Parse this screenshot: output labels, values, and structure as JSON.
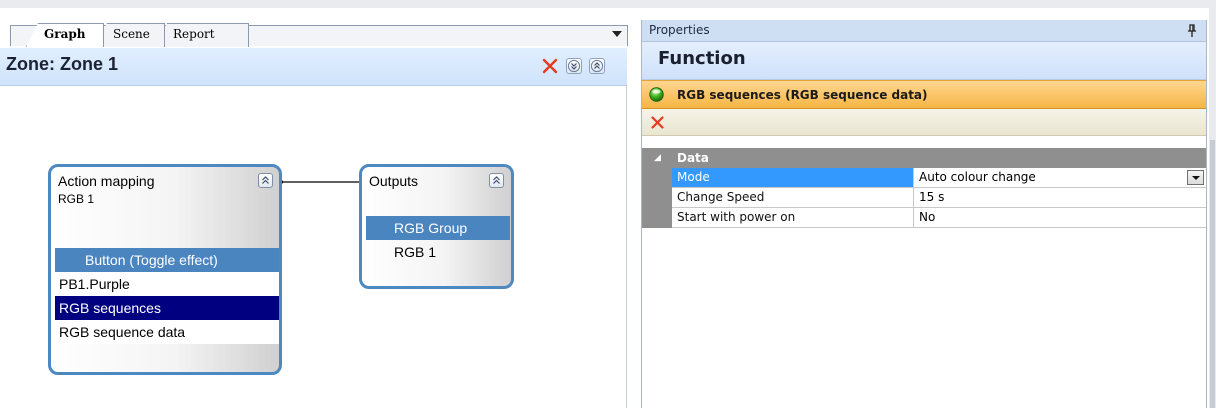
{
  "tabs": [
    "Graph",
    "Scene",
    "Report"
  ],
  "zone": {
    "title": "Zone: Zone 1"
  },
  "nodes": {
    "action": {
      "title": "Action mapping",
      "subtitle": "RGB 1",
      "items": [
        "Button (Toggle effect)",
        "PB1.Purple",
        "RGB sequences",
        "RGB sequence data"
      ]
    },
    "outputs": {
      "title": "Outputs",
      "items": [
        "RGB Group",
        "RGB 1"
      ]
    }
  },
  "properties": {
    "title": "Properties",
    "heading": "Function",
    "selected_item": "RGB sequences (RGB sequence data)",
    "category": "Data",
    "rows": [
      {
        "name": "Mode",
        "value": "Auto colour change"
      },
      {
        "name": "Change Speed",
        "value": "15 s"
      },
      {
        "name": "Start with power on",
        "value": "No"
      }
    ]
  },
  "colors": {
    "node_border": "#4e88c0",
    "highlight": "#4a85c0",
    "selected_navy": "#000080",
    "grid_selection": "#3399ff",
    "orange_bar": "#f5b544",
    "delete_red": "#e03020"
  },
  "icons": [
    "dropdown-arrow-icon",
    "close-icon",
    "expand-all-icon",
    "collapse-all-icon",
    "collapse-icon",
    "pin-icon",
    "green-status-icon",
    "delete-icon",
    "expand-arrow-icon"
  ]
}
